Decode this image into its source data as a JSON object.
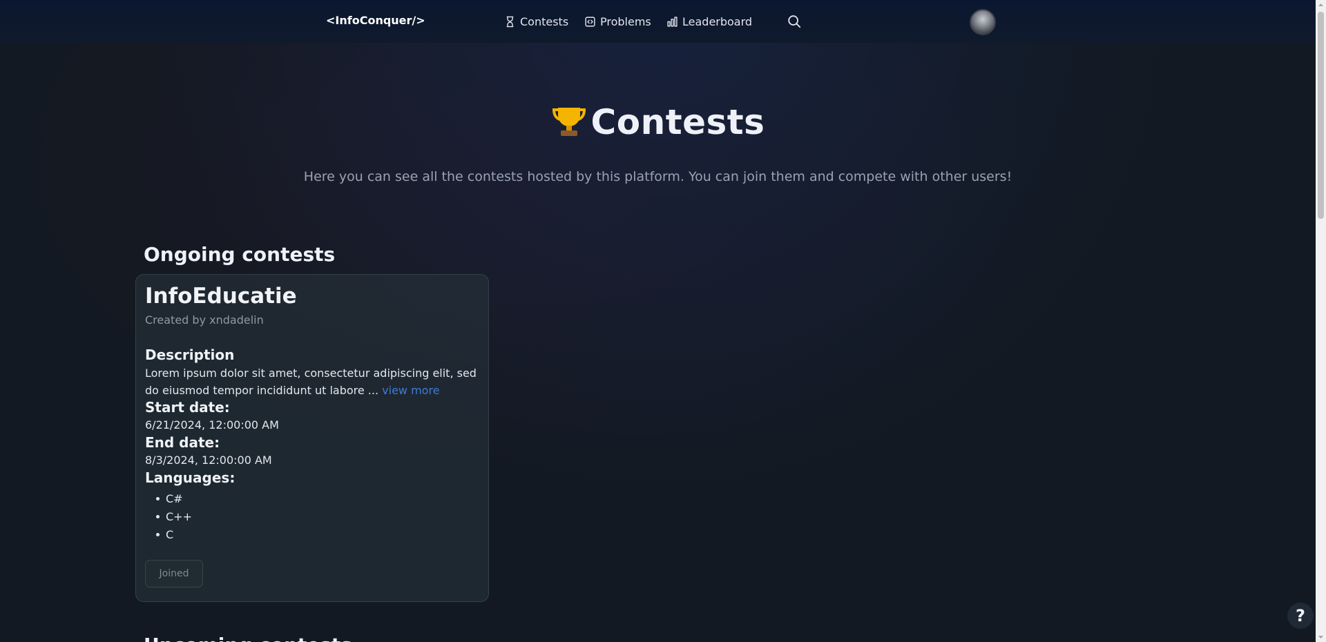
{
  "nav": {
    "brand": "<InfoConquer/>",
    "links": [
      {
        "label": "Contests",
        "icon": "hourglass-icon"
      },
      {
        "label": "Problems",
        "icon": "code-icon"
      },
      {
        "label": "Leaderboard",
        "icon": "bar-chart-icon"
      }
    ],
    "search_icon": "search-icon",
    "avatar_icon": "avatar"
  },
  "hero": {
    "title": "Contests",
    "title_icon": "trophy-icon",
    "subtitle": "Here you can see all the contests hosted by this platform. You can join them and compete with other users!"
  },
  "sections": {
    "ongoing": "Ongoing contests",
    "upcoming": "Upcoming contests"
  },
  "contest": {
    "title": "InfoEducatie",
    "author": "Created by xndadelin",
    "description_label": "Description",
    "description": "Lorem ipsum dolor sit amet, consectetur adipiscing elit, sed do eiusmod tempor incididunt ut labore ... ",
    "view_more": "view more",
    "start_label": "Start date:",
    "start_date": "6/21/2024, 12:00:00 AM",
    "end_label": "End date:",
    "end_date": "8/3/2024, 12:00:00 AM",
    "languages_label": "Languages:",
    "languages": [
      "C#",
      "C++",
      "C"
    ],
    "button": "Joined"
  },
  "help": "?",
  "colors": {
    "background": "#131922",
    "nav": "#0b1730",
    "link": "#3f7bd8",
    "muted": "#9aa3b2"
  }
}
